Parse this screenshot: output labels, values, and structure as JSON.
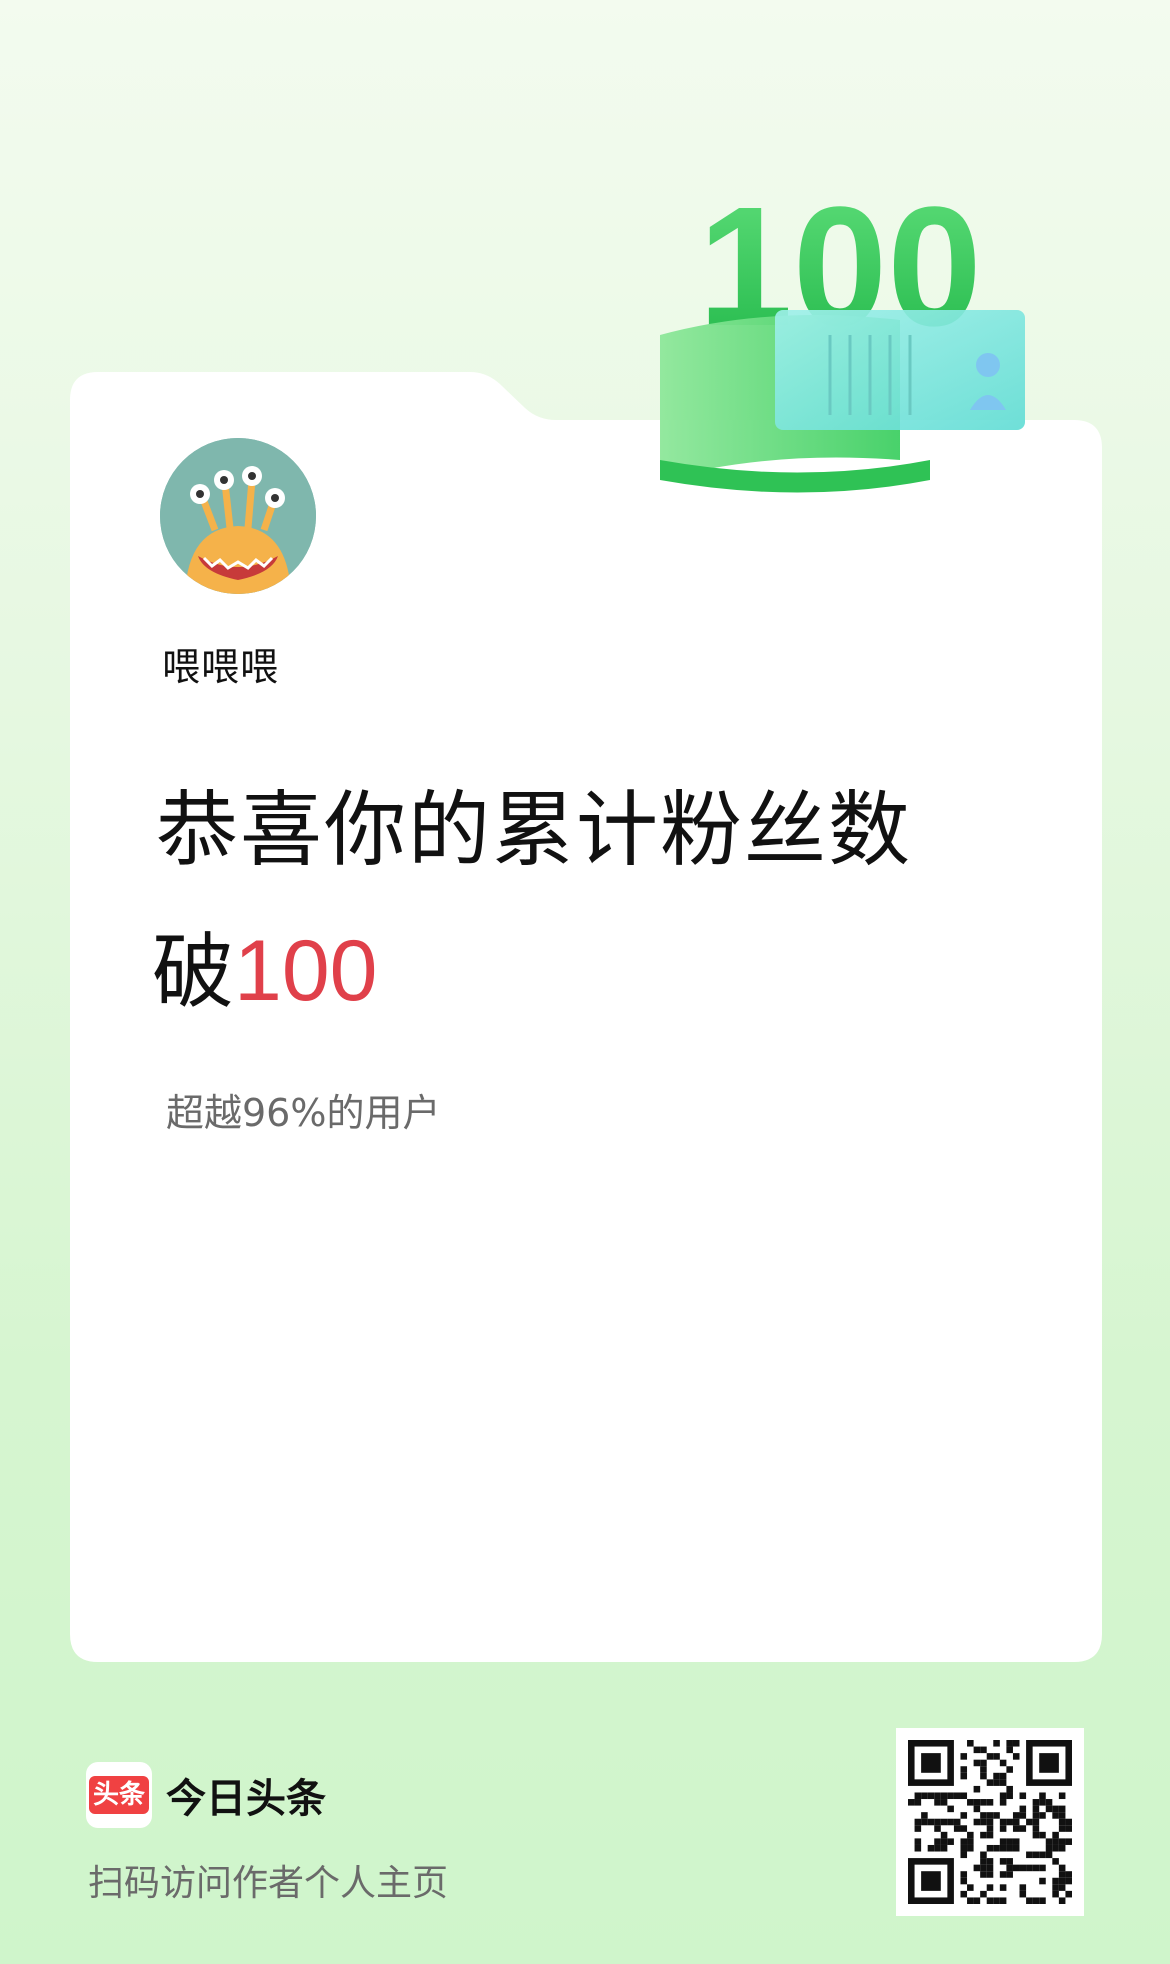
{
  "badge": {
    "number": "100"
  },
  "user": {
    "name": "喂喂喂"
  },
  "headline": {
    "line1": "恭喜你的累计粉丝数",
    "line2_prefix": "破",
    "line2_number": "100"
  },
  "subtitle": "超越96%的用户",
  "footer": {
    "app_logo_text": "头条",
    "app_name": "今日头条",
    "scan_tip": "扫码访问作者个人主页"
  },
  "colors": {
    "accent_red": "#e0404a",
    "badge_green": "#35c85a",
    "background_green": "#d6f5d0"
  }
}
